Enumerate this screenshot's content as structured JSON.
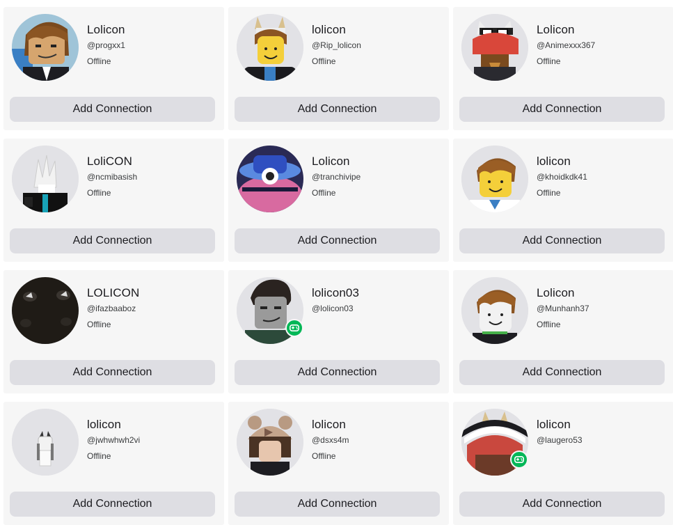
{
  "button_label": "Add Connection",
  "colors": {
    "card_bg": "#f6f6f6",
    "button_bg": "#dedee3",
    "online_badge": "#02b757",
    "avatar_bg": "#e2e2e6"
  },
  "cards": [
    {
      "display_name": "Lolicon",
      "username": "@progxx1",
      "status": "Offline",
      "avatar": "bacon-hair-smirk",
      "in_game": false
    },
    {
      "display_name": "lolicon",
      "username": "@Rip_lolicon",
      "status": "Offline",
      "avatar": "noob-horns",
      "in_game": false
    },
    {
      "display_name": "Lolicon",
      "username": "@Animexxx367",
      "status": "Offline",
      "avatar": "cat-ears-glasses",
      "in_game": false
    },
    {
      "display_name": "LoliCON",
      "username": "@ncmibasish",
      "status": "Offline",
      "avatar": "white-spiky-hair",
      "in_game": false
    },
    {
      "display_name": "Lolicon",
      "username": "@tranchivipe",
      "status": "Offline",
      "avatar": "neon-hat",
      "in_game": false
    },
    {
      "display_name": "lolicon",
      "username": "@khoidkdk41",
      "status": "Offline",
      "avatar": "bacon-hair",
      "in_game": false
    },
    {
      "display_name": "LOLICON",
      "username": "@ifazbaaboz",
      "status": "Offline",
      "avatar": "dark-closeup",
      "in_game": false
    },
    {
      "display_name": "lolicon03",
      "username": "@lolicon03",
      "status": "",
      "avatar": "gray-face",
      "in_game": true
    },
    {
      "display_name": "Lolicon",
      "username": "@Munhanh37",
      "status": "Offline",
      "avatar": "bacon-hair-white",
      "in_game": false
    },
    {
      "display_name": "lolicon",
      "username": "@jwhwhwh2vi",
      "status": "Offline",
      "avatar": "tiny-white-character",
      "in_game": false
    },
    {
      "display_name": "lolicon",
      "username": "@dsxs4m",
      "status": "Offline",
      "avatar": "bear-hat",
      "in_game": false
    },
    {
      "display_name": "lolicon",
      "username": "@laugero53",
      "status": "",
      "avatar": "red-hat-horns",
      "in_game": true
    }
  ]
}
